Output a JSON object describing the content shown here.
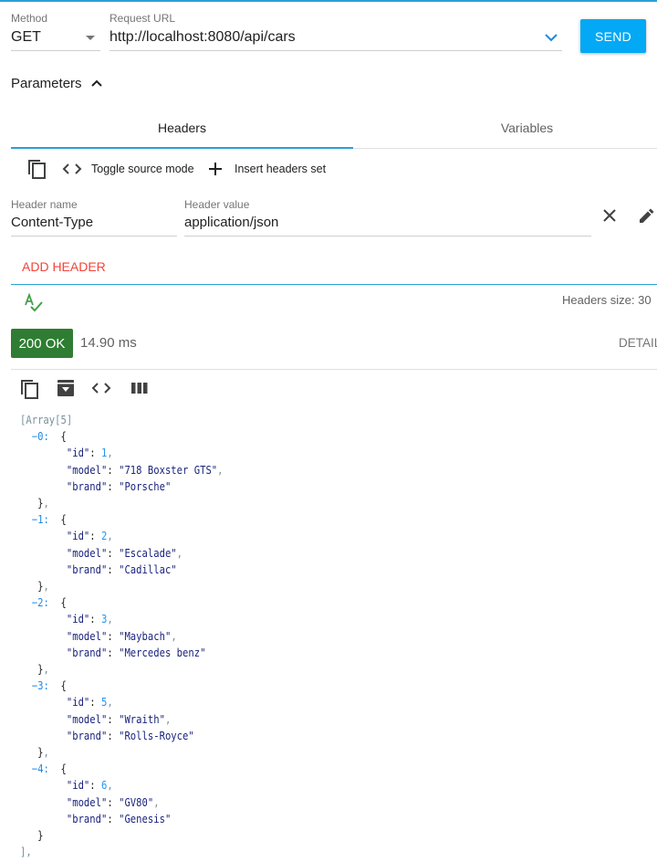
{
  "request": {
    "method_label": "Method",
    "method": "GET",
    "url_label": "Request URL",
    "url": "http://localhost:8080/api/cars",
    "send_label": "SEND"
  },
  "parameters": {
    "title": "Parameters"
  },
  "tabs": [
    {
      "label": "Headers",
      "active": true
    },
    {
      "label": "Variables",
      "active": false
    }
  ],
  "header_toolbar": {
    "toggle_source": "Toggle source mode",
    "insert_set": "Insert headers set"
  },
  "header_row": {
    "name_label": "Header name",
    "name": "Content-Type",
    "value_label": "Header value",
    "value": "application/json"
  },
  "add_header_label": "ADD HEADER",
  "headers_size": "Headers size: 30",
  "response": {
    "status": "200 OK",
    "time": "14.90 ms",
    "details_label": "DETAIL"
  },
  "json": {
    "root": "[Array[5]",
    "items": [
      {
        "index": "0",
        "id": "1",
        "model": "\"718 Boxster GTS\"",
        "brand": "\"Porsche\""
      },
      {
        "index": "1",
        "id": "2",
        "model": "\"Escalade\"",
        "brand": "\"Cadillac\""
      },
      {
        "index": "2",
        "id": "3",
        "model": "\"Maybach\"",
        "brand": "\"Mercedes benz\""
      },
      {
        "index": "3",
        "id": "5",
        "model": "\"Wraith\"",
        "brand": "\"Rolls-Royce\""
      },
      {
        "index": "4",
        "id": "6",
        "model": "\"GV80\"",
        "brand": "\"Genesis\""
      }
    ],
    "key_id": "\"id\"",
    "key_model": "\"model\"",
    "key_brand": "\"brand\""
  },
  "colors": {
    "accent": "#03a9f4",
    "tab_indicator": "#2aa0d6",
    "status_ok": "#2e7d32",
    "add_header": "#f44336",
    "validate_icon": "#43a047"
  }
}
